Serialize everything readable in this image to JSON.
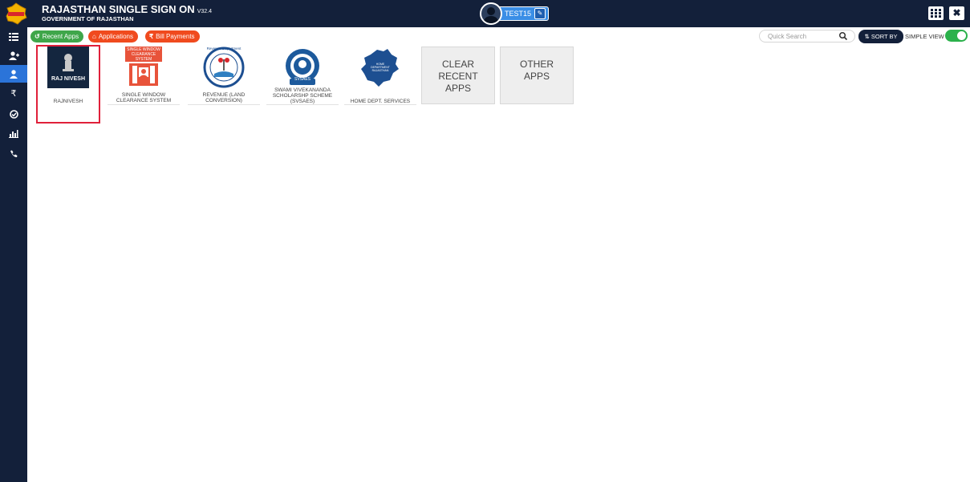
{
  "header": {
    "title": "RAJASTHAN SINGLE SIGN ON",
    "version": "V32.4",
    "subtitle": "GOVERNMENT OF RAJASTHAN",
    "user_name": "TEST15"
  },
  "sidebar": {
    "items": [
      {
        "icon": "list-icon"
      },
      {
        "icon": "add-user-icon"
      },
      {
        "icon": "user-icon",
        "active": true
      },
      {
        "icon": "rupee-icon",
        "glyph": "₹"
      },
      {
        "icon": "check-circle-icon"
      },
      {
        "icon": "bar-chart-icon"
      },
      {
        "icon": "phone-icon"
      }
    ]
  },
  "tabs": [
    {
      "label": "Recent Apps",
      "color": "#3fa64a"
    },
    {
      "label": "Applications",
      "color": "#f04a1e"
    },
    {
      "label": "Bill Payments",
      "color": "#f04a1e"
    }
  ],
  "toolbar": {
    "search_placeholder": "Quick Search",
    "sort_label": "SORT BY",
    "simple_view_label": "SIMPLE VIEW",
    "simple_view_on": true
  },
  "apps": [
    {
      "label": "RAJNIVESH",
      "logo_text": "RAJ NIVESH",
      "selected": true
    },
    {
      "label_lines": [
        "SINGLE WINDOW",
        "CLEARANCE SYSTEM"
      ],
      "logo_text_lines": [
        "SINGLE WINDOW",
        "CLEARANCE",
        "SYSTEM"
      ]
    },
    {
      "label_lines": [
        "REVENUE (LAND",
        "CONVERSION)"
      ],
      "logo_text": "Revenue Department"
    },
    {
      "label_lines": [
        "SWAMI VIVEKANANDA",
        "SCHOLARSHP SCHEME",
        "(SVSAES)"
      ],
      "logo_text": "SVSAES"
    },
    {
      "label": "HOME DEPT. SERVICES",
      "logo_text_lines": [
        "HOME",
        "DEPARTMENT",
        "RAJASTHAN"
      ]
    }
  ],
  "actions": [
    {
      "label_lines": [
        "CLEAR",
        "RECENT",
        "APPS"
      ]
    },
    {
      "label_lines": [
        "OTHER",
        "APPS"
      ]
    }
  ],
  "colors": {
    "header_bg": "#13203a",
    "sidebar_active": "#2b74d9",
    "accent_green": "#3fa64a",
    "accent_orange": "#f04a1e",
    "selection_border": "#e0203a"
  }
}
